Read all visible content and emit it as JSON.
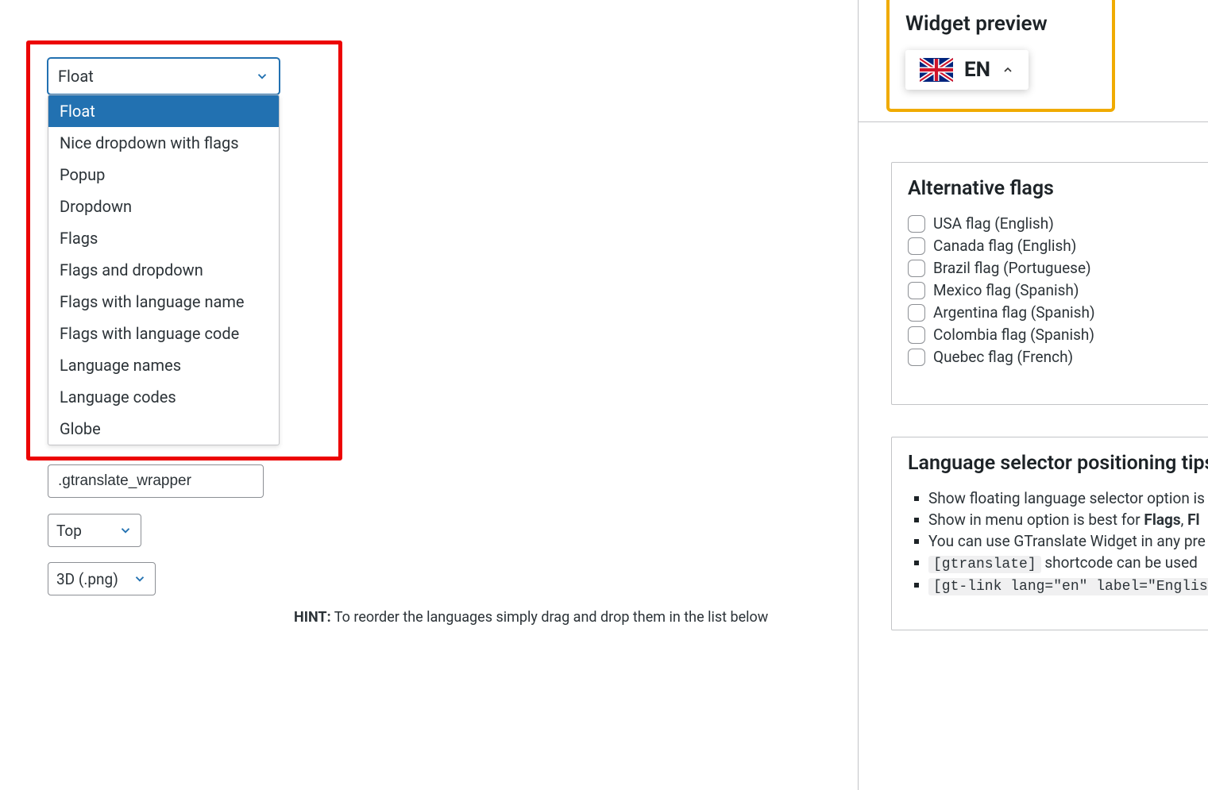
{
  "main_select": {
    "value": "Float",
    "options": [
      "Float",
      "Nice dropdown with flags",
      "Popup",
      "Dropdown",
      "Flags",
      "Flags and dropdown",
      "Flags with language name",
      "Flags with language code",
      "Language names",
      "Language codes",
      "Globe"
    ]
  },
  "wrapper_input": ".gtranslate_wrapper",
  "position_select": "Top",
  "style_select": "3D (.png)",
  "hint_label": "HINT:",
  "hint_text": "To reorder the languages simply drag and drop them in the list below",
  "preview": {
    "title": "Widget preview",
    "lang_code": "EN"
  },
  "alt_flags": {
    "title": "Alternative flags",
    "items": [
      "USA flag (English)",
      "Canada flag (English)",
      "Brazil flag (Portuguese)",
      "Mexico flag (Spanish)",
      "Argentina flag (Spanish)",
      "Colombia flag (Spanish)",
      "Quebec flag (French)"
    ]
  },
  "tips": {
    "title": "Language selector positioning tips",
    "items": [
      {
        "pre": "Show floating language selector option is",
        "code": null,
        "post": null,
        "strong": null
      },
      {
        "pre": "Show in menu option is best for ",
        "strong": "Flags",
        "post_strong": ", ",
        "strong2": "Fl",
        "code": null,
        "post": null
      },
      {
        "pre": "You can use GTranslate Widget in any pre",
        "code": null,
        "post": null,
        "strong": null
      },
      {
        "pre": null,
        "code": "[gtranslate]",
        "post": " shortcode can be used",
        "strong": null
      },
      {
        "pre": null,
        "code": "[gt-link lang=\"en\" label=\"Englis",
        "post": null,
        "strong": null
      }
    ]
  }
}
